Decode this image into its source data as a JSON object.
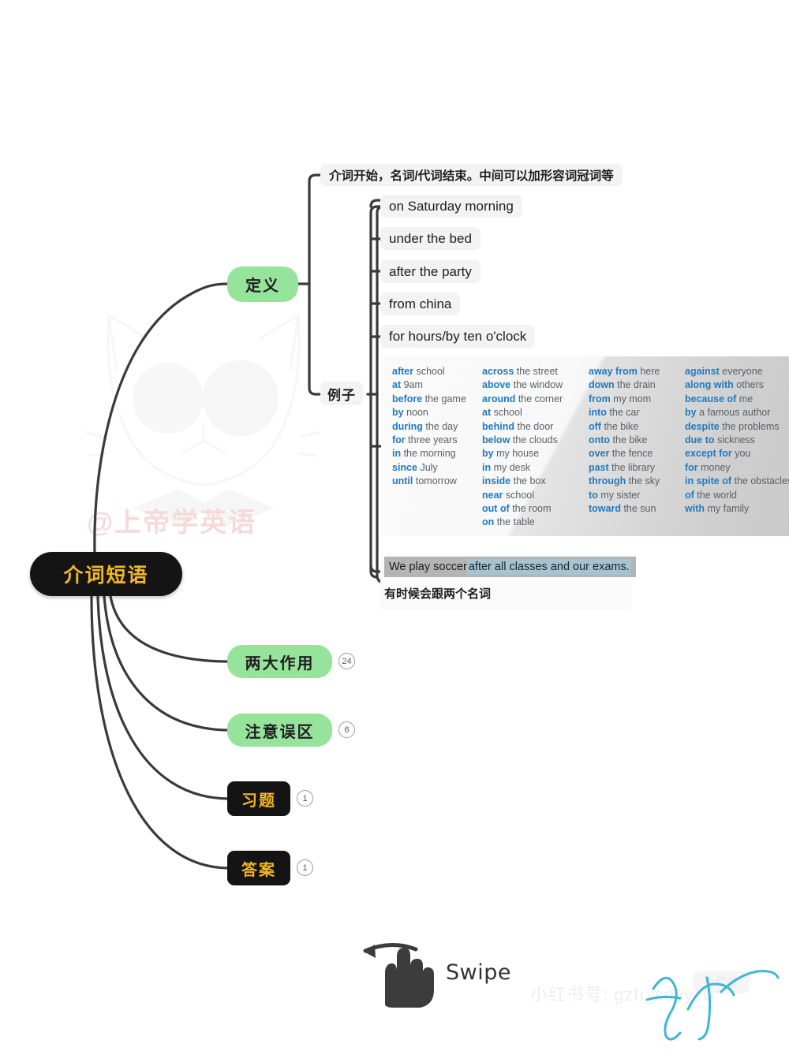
{
  "root": {
    "label": "介词短语"
  },
  "branches": [
    {
      "id": "dingyi",
      "label": "定义",
      "style": "green",
      "badge": null
    },
    {
      "id": "liangda",
      "label": "两大作用",
      "style": "green",
      "badge": "24"
    },
    {
      "id": "zhuyi",
      "label": "注意误区",
      "style": "green",
      "badge": "6"
    },
    {
      "id": "xiti",
      "label": "习题",
      "style": "black",
      "badge": "1"
    },
    {
      "id": "daan",
      "label": "答案",
      "style": "black",
      "badge": "1"
    }
  ],
  "definition": {
    "text": "介词开始，名词/代词结束。中间可以加形容词冠词等"
  },
  "examples_node": {
    "label": "例子"
  },
  "examples": [
    "on Saturday morning",
    "under the bed",
    "after the party",
    "from china",
    "for hours/by ten o'clock"
  ],
  "prep_table": {
    "columns": [
      {
        "name": "time",
        "rows": [
          {
            "prep": "after",
            "obj": "school"
          },
          {
            "prep": "at",
            "obj": "9am"
          },
          {
            "prep": "before",
            "obj": "the game"
          },
          {
            "prep": "by",
            "obj": "noon"
          },
          {
            "prep": "during",
            "obj": "the day"
          },
          {
            "prep": "for",
            "obj": "three years"
          },
          {
            "prep": "in",
            "obj": "the morning"
          },
          {
            "prep": "since",
            "obj": "July"
          },
          {
            "prep": "until",
            "obj": "tomorrow"
          }
        ]
      },
      {
        "name": "place-a",
        "rows": [
          {
            "prep": "across",
            "obj": "the street"
          },
          {
            "prep": "above",
            "obj": "the window"
          },
          {
            "prep": "around",
            "obj": "the corner"
          },
          {
            "prep": "at",
            "obj": "school"
          },
          {
            "prep": "behind",
            "obj": "the door"
          },
          {
            "prep": "below",
            "obj": "the clouds"
          },
          {
            "prep": "by",
            "obj": "my house"
          },
          {
            "prep": "in",
            "obj": "my desk"
          },
          {
            "prep": "inside",
            "obj": "the box"
          },
          {
            "prep": "near",
            "obj": "school"
          },
          {
            "prep": "out of",
            "obj": "the room"
          },
          {
            "prep": "on",
            "obj": "the table"
          }
        ]
      },
      {
        "name": "direction",
        "rows": [
          {
            "prep": "away from",
            "obj": "here"
          },
          {
            "prep": "down",
            "obj": "the drain"
          },
          {
            "prep": "from",
            "obj": "my mom"
          },
          {
            "prep": "into",
            "obj": "the car"
          },
          {
            "prep": "off",
            "obj": "the bike"
          },
          {
            "prep": "onto",
            "obj": "the bike"
          },
          {
            "prep": "over",
            "obj": "the fence"
          },
          {
            "prep": "past",
            "obj": "the library"
          },
          {
            "prep": "through",
            "obj": "the sky"
          },
          {
            "prep": "to",
            "obj": "my sister"
          },
          {
            "prep": "toward",
            "obj": "the sun"
          }
        ]
      },
      {
        "name": "other",
        "rows": [
          {
            "prep": "against",
            "obj": "everyone"
          },
          {
            "prep": "along with",
            "obj": "others"
          },
          {
            "prep": "because of",
            "obj": "me"
          },
          {
            "prep": "by",
            "obj": "a famous author"
          },
          {
            "prep": "despite",
            "obj": "the problems"
          },
          {
            "prep": "due to",
            "obj": "sickness"
          },
          {
            "prep": "except for",
            "obj": "you"
          },
          {
            "prep": "for",
            "obj": "money"
          },
          {
            "prep": "in spite of",
            "obj": "the obstacles"
          },
          {
            "prep": "of",
            "obj": "the world"
          },
          {
            "prep": "with",
            "obj": "my family"
          }
        ]
      }
    ]
  },
  "sentence": {
    "plain": "We play soccer ",
    "highlight": "after all classes and our exams.",
    "note": "有时候会跟两个名词"
  },
  "swipe": {
    "label": "Swipe"
  },
  "watermarks": {
    "brand": "@上帝学英语",
    "xhs_account": "小红书号: gzh_sdyyzb",
    "xhs_logo": "小红书"
  },
  "colors": {
    "root_bg": "#141414",
    "root_text": "#f2b722",
    "green_node": "#96e39b",
    "prep_blue": "#1f7ac0",
    "highlight": "#a7c3d2",
    "line": "#3a3a3a"
  }
}
